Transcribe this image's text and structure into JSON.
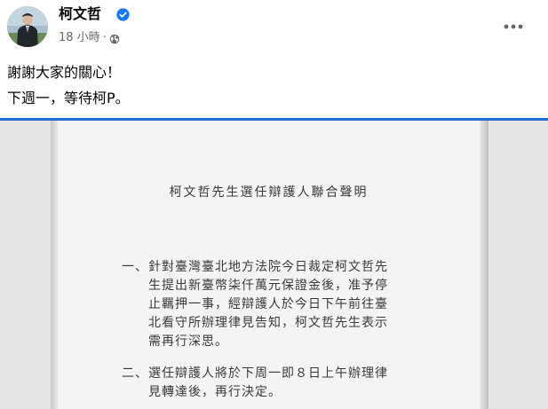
{
  "author": {
    "name": "柯文哲",
    "verified_icon": "verified-badge-icon",
    "verified_color": "#1877f2"
  },
  "meta": {
    "time": "18 小時",
    "separator": "·",
    "audience_icon": "globe-icon"
  },
  "more_icon": "more-options-icon",
  "post": {
    "lines": [
      "謝謝大家的關心！",
      "下週一，等待柯P。"
    ]
  },
  "document": {
    "title": "柯文哲先生選任辯護人聯合聲明",
    "items": [
      {
        "number": "一、",
        "lines": [
          "針對臺灣臺北地方法院今日裁定柯文哲先",
          "生提出新臺幣柒仟萬元保證金後，准予停",
          "止羈押一事，經辯護人於今日下午前往臺",
          "北看守所辦理律見告知，柯文哲先生表示",
          "需再行深思。"
        ]
      },
      {
        "number": "二、",
        "lines": [
          "選任辯護人將於下周一即８日上午辦理律",
          "見轉達後，再行決定。"
        ]
      }
    ]
  },
  "colors": {
    "divider": "#1f6fd1",
    "name_text": "#050505",
    "meta_text": "#65676b"
  }
}
